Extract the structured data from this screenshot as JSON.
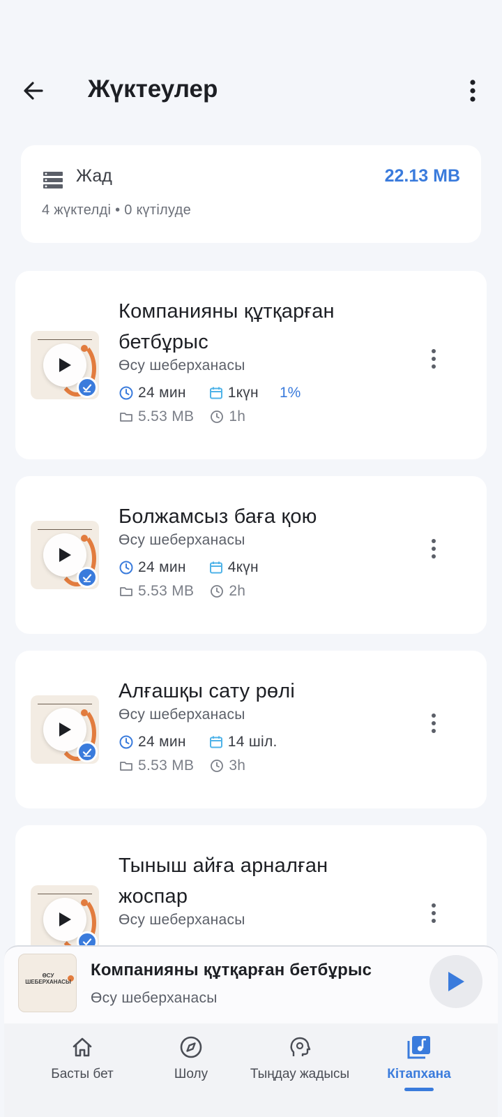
{
  "header": {
    "title": "Жүктеулер",
    "back_icon": "arrow-left-icon",
    "more_icon": "more-vertical-icon"
  },
  "storage": {
    "label": "Жад",
    "value": "22.13 MB",
    "summary": "4 жүктелді • 0 күтілуде",
    "icon": "storage-list-icon"
  },
  "downloads": [
    {
      "title_line1": "Компанияны құтқарған",
      "title_line2": "бетбұрыс",
      "author": "Өсу шеберханасы",
      "duration": "24 мин",
      "date": "1күн",
      "progress": "1%",
      "size": "5.53 MB",
      "time_ago": "1h"
    },
    {
      "title_line1": "Болжамсыз баға қою",
      "title_line2": "",
      "author": "Өсу шеберханасы",
      "duration": "24 мин",
      "date": "4күн",
      "progress": "",
      "size": "5.53 MB",
      "time_ago": "2h"
    },
    {
      "title_line1": "Алғашқы сату рөлі",
      "title_line2": "",
      "author": "Өсу шеберханасы",
      "duration": "24 мин",
      "date": "14 шіл.",
      "progress": "",
      "size": "5.53 MB",
      "time_ago": "3h"
    },
    {
      "title_line1": "Тыныш айға арналған",
      "title_line2": "жоспар",
      "author": "Өсу шеберханасы",
      "duration": "",
      "date": "",
      "progress": "",
      "size": "",
      "time_ago": ""
    }
  ],
  "mini_player": {
    "title": "Компанияны құтқарған бетбұрыс",
    "author": "Өсу шеберханасы",
    "cover_text": "ӨСУ ШЕБЕРХАНАСЫ",
    "play_icon": "play-icon"
  },
  "nav": {
    "items": [
      {
        "label": "Басты бет",
        "icon": "home-icon"
      },
      {
        "label": "Шолу",
        "icon": "compass-icon"
      },
      {
        "label": "Тыңдау жадысы",
        "icon": "brain-icon"
      },
      {
        "label": "Кітапхана",
        "icon": "library-music-icon"
      }
    ],
    "active_index": 3
  },
  "colors": {
    "accent": "#3a7bdc",
    "background": "#f4f6fa",
    "cover_orange": "#e27c3e"
  }
}
